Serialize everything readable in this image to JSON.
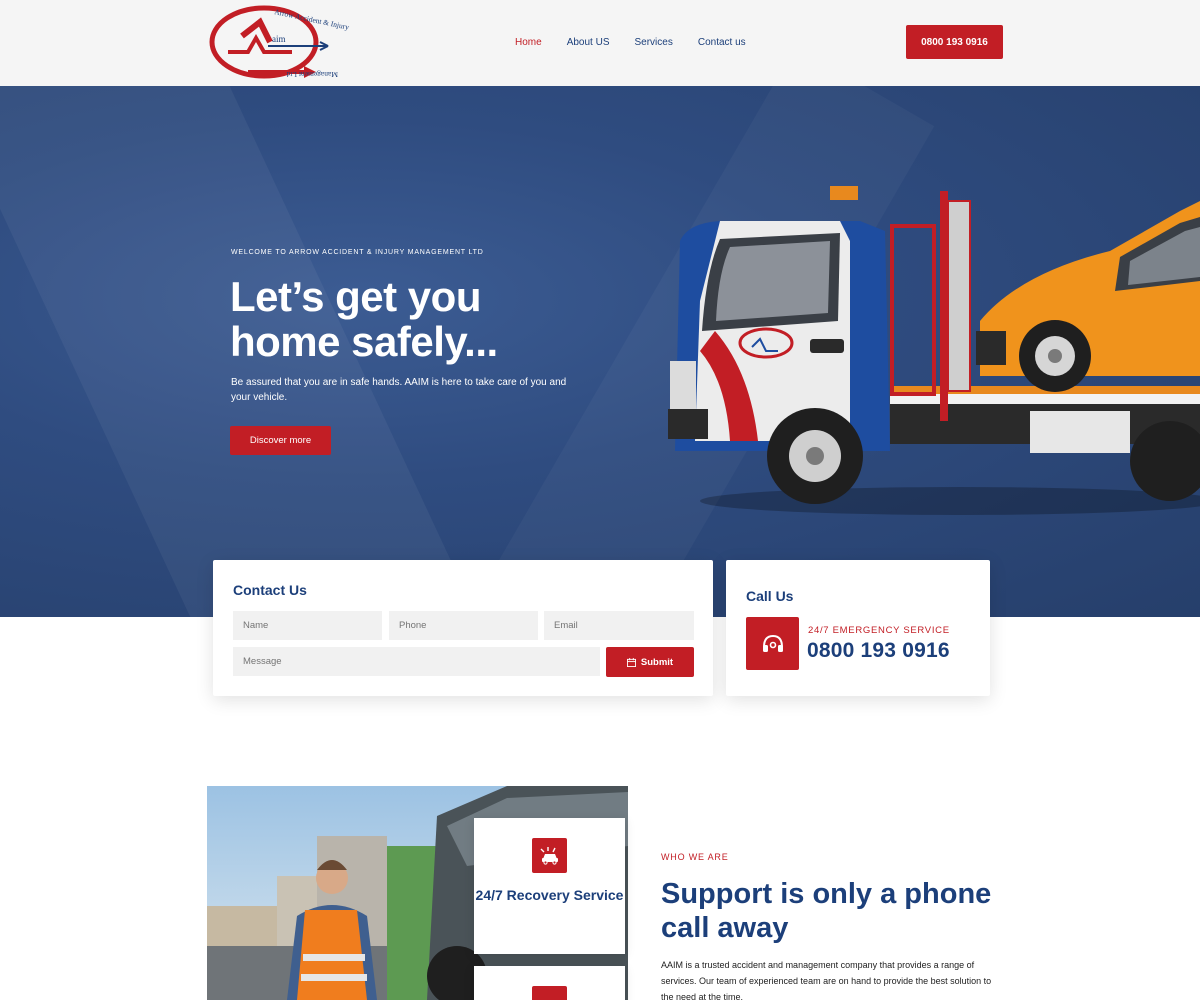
{
  "brand": {
    "logo_text_top": "Arrow Accident & Injury",
    "logo_text_bottom": "Management Ltd",
    "logo_mark": "aim",
    "colors": {
      "primary": "#1c3f7a",
      "accent": "#c21e25",
      "header_bg": "#f5f5f5"
    }
  },
  "nav": {
    "items": [
      {
        "label": "Home",
        "active": true
      },
      {
        "label": "About US",
        "active": false
      },
      {
        "label": "Services",
        "active": false
      },
      {
        "label": "Contact us",
        "active": false
      }
    ],
    "phone_button": "0800 193 0916"
  },
  "hero": {
    "kicker": "WELCOME TO ARROW ACCIDENT & INJURY MANAGEMENT LTD",
    "title": "Let’s get you home safely...",
    "subtitle": "Be assured that you are in safe hands. AAIM is here to take care of you and your vehicle.",
    "button": "Discover more"
  },
  "contact_form": {
    "title": "Contact Us",
    "name_placeholder": "Name",
    "phone_placeholder": "Phone",
    "email_placeholder": "Email",
    "message_placeholder": "Message",
    "submit_label": "Submit",
    "submit_icon": "calendar-icon"
  },
  "call_card": {
    "title": "Call Us",
    "icon": "headset-icon",
    "label": "24/7 EMERGENCY SERVICE",
    "number": "0800 193 0916"
  },
  "services": [
    {
      "label": "24/7 Recovery Service",
      "icon": "car-crash-icon"
    }
  ],
  "who_we_are": {
    "kicker": "WHO WE ARE",
    "title": "Support is only a phone call away",
    "text": "AAIM is a trusted accident and management company that provides a range of services. Our team of experienced team are on hand to provide the best solution to the need at the time."
  }
}
